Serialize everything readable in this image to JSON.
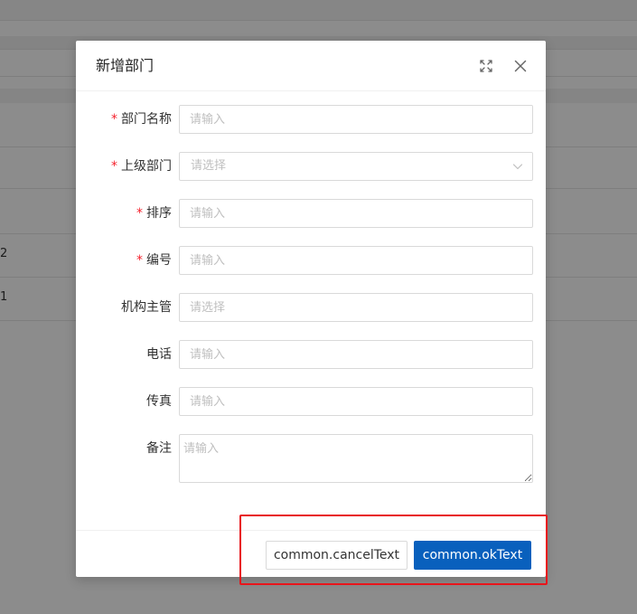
{
  "background": {
    "row_fragments": [
      "",
      "",
      "2",
      "1"
    ]
  },
  "modal": {
    "title": "新增部门",
    "fields": [
      {
        "label": "部门名称",
        "required": true,
        "type": "input",
        "placeholder": "请输入"
      },
      {
        "label": "上级部门",
        "required": true,
        "type": "select",
        "placeholder": "请选择"
      },
      {
        "label": "排序",
        "required": true,
        "type": "input",
        "placeholder": "请输入"
      },
      {
        "label": "编号",
        "required": true,
        "type": "input",
        "placeholder": "请输入"
      },
      {
        "label": "机构主管",
        "required": false,
        "type": "input",
        "placeholder": "请选择"
      },
      {
        "label": "电话",
        "required": false,
        "type": "input",
        "placeholder": "请输入"
      },
      {
        "label": "传真",
        "required": false,
        "type": "input",
        "placeholder": "请输入"
      },
      {
        "label": "备注",
        "required": false,
        "type": "textarea",
        "placeholder": "请输入"
      }
    ],
    "required_mark": "*",
    "footer": {
      "cancel_label": "common.cancelText",
      "ok_label": "common.okText"
    }
  },
  "colors": {
    "primary": "#0960bd",
    "required": "#f5222d",
    "highlight": "#e8151b"
  },
  "icons": {
    "expand": "fullscreen-icon",
    "close": "close-icon",
    "select_arrow": "chevron-down-icon"
  }
}
